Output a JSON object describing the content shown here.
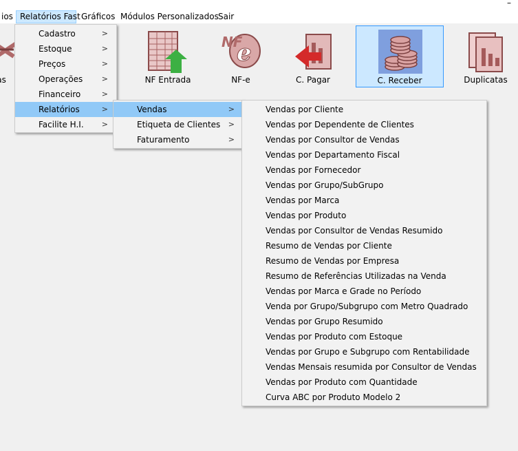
{
  "window": {
    "minimize_glyph": "–"
  },
  "menubar": {
    "items": [
      "ios",
      "Relatórios Fast",
      "Gráficos",
      "Módulos Personalizados",
      "Sair"
    ]
  },
  "toolbar": {
    "left_partial_label": "ndas",
    "buttons": [
      {
        "label": "NF Entrada",
        "underline": "N",
        "rest": "F Entrada",
        "icon": "spreadsheet-upload-icon"
      },
      {
        "label": "NF-e",
        "icon": "nfe-logo-icon"
      },
      {
        "label": "C. Pagar",
        "icon": "pay-arrow-icon"
      },
      {
        "label": "C. Receber",
        "icon": "coins-stack-icon",
        "selected": true
      },
      {
        "label": "Duplicatas",
        "icon": "documents-icon"
      }
    ]
  },
  "menu_l1": {
    "items": [
      "Cadastro",
      "Estoque",
      "Preços",
      "Operações",
      "Financeiro",
      "Relatórios",
      "Facilite H.I."
    ],
    "highlighted": "Relatórios"
  },
  "menu_l2": {
    "items": [
      "Vendas",
      "Etiqueta de Clientes",
      "Faturamento"
    ],
    "highlighted": "Vendas"
  },
  "menu_l3": {
    "items": [
      "Vendas por Cliente",
      "Vendas por Dependente de Clientes",
      "Vendas por Consultor de Vendas",
      "Vendas por Departamento Fiscal",
      "Vendas por Fornecedor",
      "Vendas por Grupo/SubGrupo",
      "Vendas por Marca",
      "Vendas por Produto",
      "Vendas por Consultor de Vendas Resumido",
      "Resumo de Vendas por Cliente",
      "Resumo de Vendas por Empresa",
      "Resumo de Referências Utilizadas na Venda",
      "Vendas por Marca e Grade no Período",
      "Venda por Grupo/Subgrupo com Metro Quadrado",
      "Vendas por Grupo Resumido",
      "Vendas por Produto com Estoque",
      "Vendas por Grupo e Subgrupo com Rentabilidade",
      "Vendas Mensais resumida por Consultor de Vendas",
      "Vendas por Produto com Quantidade",
      "Curva ABC por Produto Modelo 2"
    ]
  },
  "submenu_arrow": ">"
}
